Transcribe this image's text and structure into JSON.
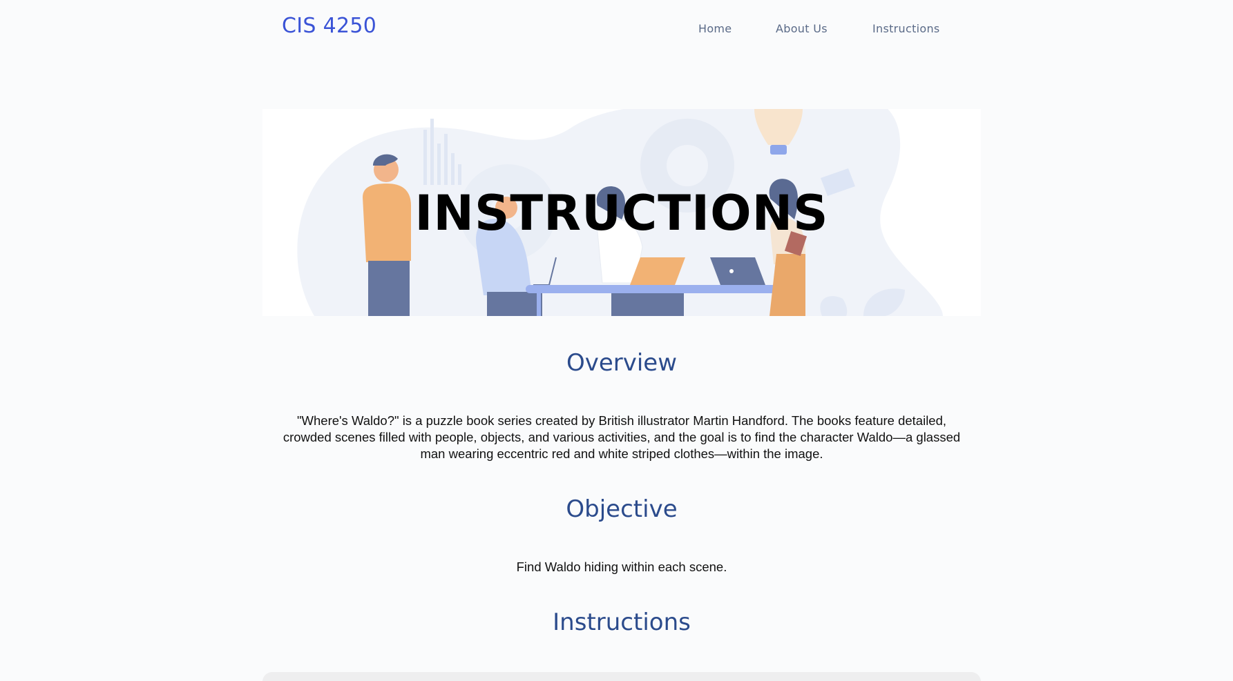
{
  "header": {
    "brand": "CIS 4250",
    "nav": {
      "home": "Home",
      "about": "About Us",
      "instructions": "Instructions"
    }
  },
  "hero": {
    "title": "INSTRUCTIONS"
  },
  "sections": {
    "overview": {
      "heading": "Overview",
      "text": "\"Where's Waldo?\" is a puzzle book series created by British illustrator Martin Handford. The books feature detailed, crowded scenes filled with people, objects, and various activities, and the goal is to find the character Waldo—a glassed man wearing eccentric red and white striped clothes—within the image."
    },
    "objective": {
      "heading": "Objective",
      "text": "Find Waldo hiding within each scene."
    },
    "instructions": {
      "heading": "Instructions"
    }
  },
  "colors": {
    "brand": "#3a53d6",
    "nav_text": "#5a6a87",
    "heading": "#2b4b8c",
    "background": "#fafbfc"
  }
}
